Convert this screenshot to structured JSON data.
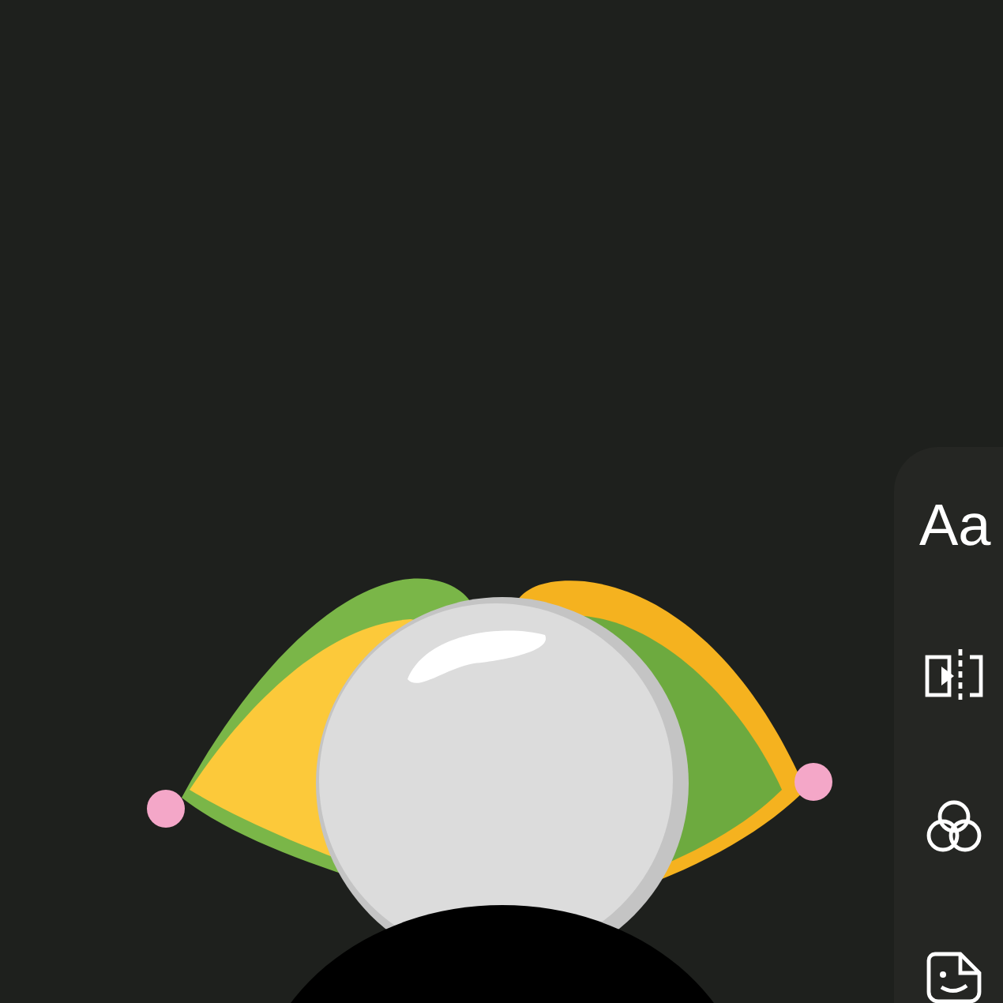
{
  "toolbar": {
    "items": [
      {
        "kind": "text",
        "label": "Aa"
      },
      {
        "kind": "split"
      },
      {
        "kind": "filter"
      },
      {
        "kind": "sticker"
      }
    ]
  }
}
